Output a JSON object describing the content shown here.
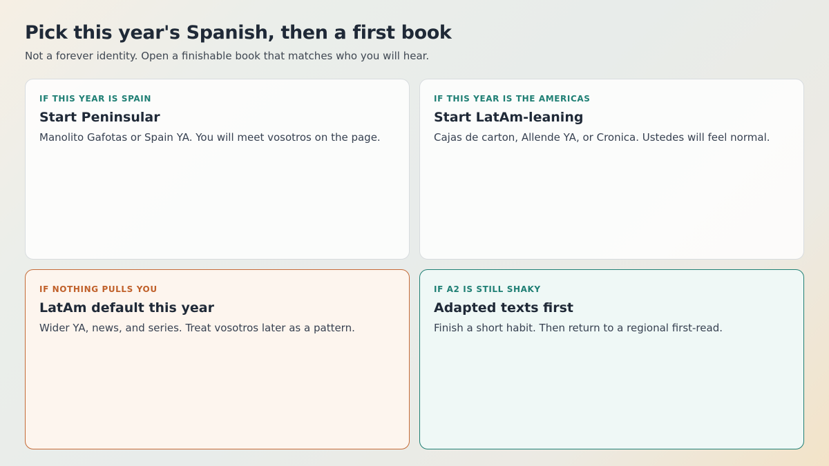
{
  "header": {
    "title": "Pick this year's Spanish, then a first book",
    "subtitle": "Not a forever identity. Open a finishable book that matches who you will hear."
  },
  "cards": [
    {
      "eyebrow": "IF THIS YEAR IS SPAIN",
      "title": "Start Peninsular",
      "body": "Manolito Gafotas or Spain YA. You will meet vosotros on the page."
    },
    {
      "eyebrow": "IF THIS YEAR IS THE AMERICAS",
      "title": "Start LatAm-leaning",
      "body": "Cajas de carton, Allende YA, or Cronica. Ustedes will feel normal."
    },
    {
      "eyebrow": "IF NOTHING PULLS YOU",
      "title": "LatAm default this year",
      "body": "Wider YA, news, and series. Treat vosotros later as a pattern."
    },
    {
      "eyebrow": "IF A2 IS STILL SHAKY",
      "title": "Adapted texts first",
      "body": "Finish a short habit. Then return to a regional first-read."
    }
  ],
  "colors": {
    "accent_teal": "#1f7f74",
    "accent_warm": "#c0602a",
    "text_dark": "#1f2937"
  }
}
